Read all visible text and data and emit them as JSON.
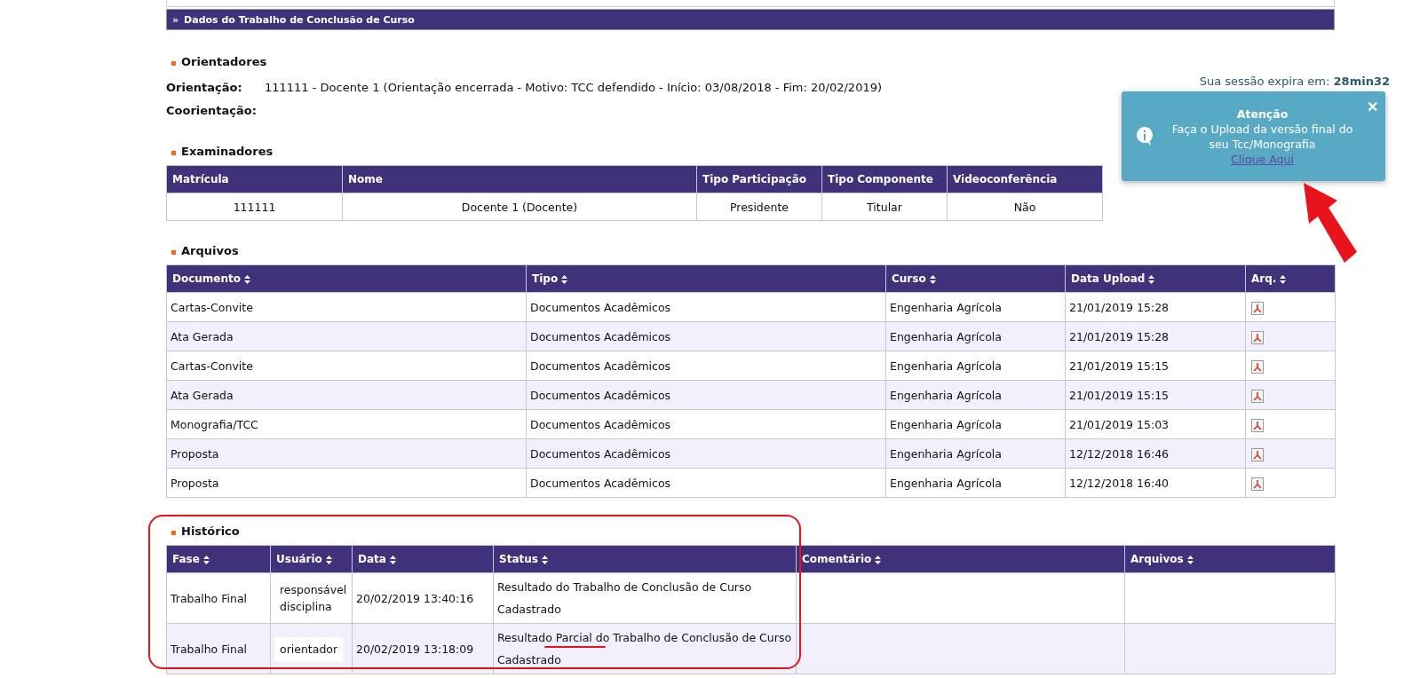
{
  "section_bar": {
    "marker": "»",
    "title": "Dados do Trabalho de Conclusão de Curso"
  },
  "orientadores": {
    "title": "Orientadores",
    "fields": [
      {
        "label": "Orientação:",
        "value": "111111 - Docente 1 (Orientação encerrada - Motivo: TCC defendido - Início: 03/08/2018 - Fim: 20/02/2019)"
      },
      {
        "label": "Coorientação:"
      }
    ]
  },
  "examinadores": {
    "title": "Examinadores",
    "columns": [
      "Matrícula",
      "Nome",
      "Tipo Participação",
      "Tipo Componente",
      "Videoconferência"
    ],
    "rows": [
      [
        "111111",
        "Docente 1 (Docente)",
        "Presidente",
        "Titular",
        "Não"
      ]
    ]
  },
  "arquivos": {
    "title": "Arquivos",
    "columns": [
      "Documento",
      "Tipo",
      "Curso",
      "Data Upload",
      "Arq."
    ],
    "rows": [
      [
        "Cartas-Convite",
        "Documentos Acadêmicos",
        "Engenharia Agrícola",
        "21/01/2019 15:28"
      ],
      [
        "Ata Gerada",
        "Documentos Acadêmicos",
        "Engenharia Agrícola",
        "21/01/2019 15:28"
      ],
      [
        "Cartas-Convite",
        "Documentos Acadêmicos",
        "Engenharia Agrícola",
        "21/01/2019 15:15"
      ],
      [
        "Ata Gerada",
        "Documentos Acadêmicos",
        "Engenharia Agrícola",
        "21/01/2019 15:15"
      ],
      [
        "Monografia/TCC",
        "Documentos Acadêmicos",
        "Engenharia Agrícola",
        "21/01/2019 15:03"
      ],
      [
        "Proposta",
        "Documentos Acadêmicos",
        "Engenharia Agrícola",
        "12/12/2018 16:46"
      ],
      [
        "Proposta",
        "Documentos Acadêmicos",
        "Engenharia Agrícola",
        "12/12/2018 16:40"
      ]
    ]
  },
  "historico": {
    "title": "Histórico",
    "columns": [
      "Fase",
      "Usuário",
      "Data",
      "Status",
      "Comentário",
      "Arquivos"
    ],
    "rows": [
      [
        "Trabalho Final",
        "responsável disciplina",
        "20/02/2019 13:40:16",
        "Resultado do Trabalho de Conclusão de Curso Cadastrado"
      ],
      [
        "Trabalho Final",
        "orientador",
        "20/02/2019 13:18:09",
        "Resultado Parcial do Trabalho de Conclusão de Curso Cadastrado"
      ]
    ]
  },
  "session": {
    "label": "Sua sessão expira em:",
    "time": "28min32"
  },
  "toast": {
    "title": "Atenção",
    "message": "Faça o Upload da versão final do seu Tcc/Monografia",
    "link": "Clique Aqui",
    "close": "✕"
  }
}
